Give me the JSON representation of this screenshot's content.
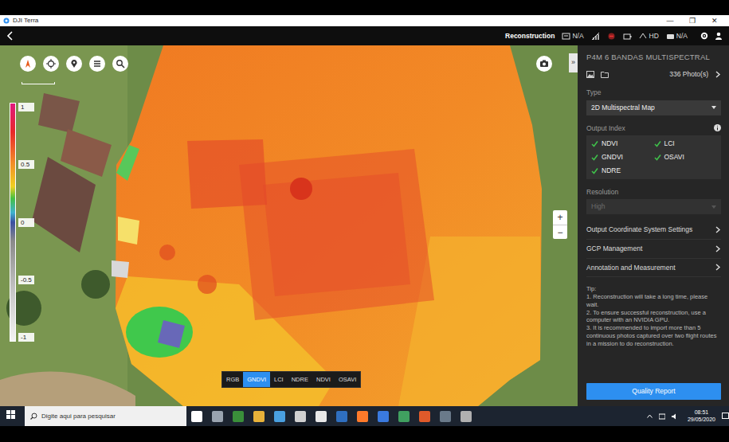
{
  "window": {
    "title": "DJI Terra",
    "controls": [
      "—",
      "❐",
      "✕"
    ]
  },
  "header": {
    "title": "Reconstruction",
    "indicators": [
      {
        "text": "N/A"
      },
      {
        "text": "HD"
      },
      {
        "text": "N/A"
      }
    ]
  },
  "map": {
    "legend": {
      "ticks": [
        "1",
        "0.5",
        "0",
        "-0.5",
        "-1"
      ]
    },
    "expand": "»",
    "zoom": [
      "+",
      "−"
    ],
    "index_tabs": [
      {
        "label": "RGB",
        "selected": false
      },
      {
        "label": "GNDVI",
        "selected": true
      },
      {
        "label": "LCI",
        "selected": false
      },
      {
        "label": "NDRE",
        "selected": false
      },
      {
        "label": "NDVI",
        "selected": false
      },
      {
        "label": "OSAVI",
        "selected": false
      }
    ]
  },
  "panel": {
    "title": "P4M 6 BANDAS MULTISPECTRAL",
    "photos": "336 Photo(s)",
    "type": {
      "label": "Type",
      "value": "2D Multispectral Map"
    },
    "output": {
      "label": "Output Index",
      "indices": [
        {
          "label": "NDVI",
          "checked": true
        },
        {
          "label": "LCI",
          "checked": true
        },
        {
          "label": "GNDVI",
          "checked": true
        },
        {
          "label": "OSAVI",
          "checked": true
        },
        {
          "label": "NDRE",
          "checked": true
        }
      ]
    },
    "resolution": {
      "label": "Resolution",
      "value": "High",
      "disabled": true
    },
    "links": [
      "Output Coordinate System Settings",
      "GCP Management",
      "Annotation and Measurement"
    ],
    "tip_title": "Tip:",
    "tips": [
      "1. Reconstruction will take a long time, please wait.",
      "2. To ensure successful reconstruction, use a computer with an NVIDIA GPU.",
      "3. It is recommended to import more than 5 continuous photos captured over two flight routes in a mission to do reconstruction."
    ],
    "button": "Quality Report"
  },
  "taskbar": {
    "search": "Digite aqui para pesquisar",
    "time": "08:51",
    "date": "29/05/2020"
  }
}
